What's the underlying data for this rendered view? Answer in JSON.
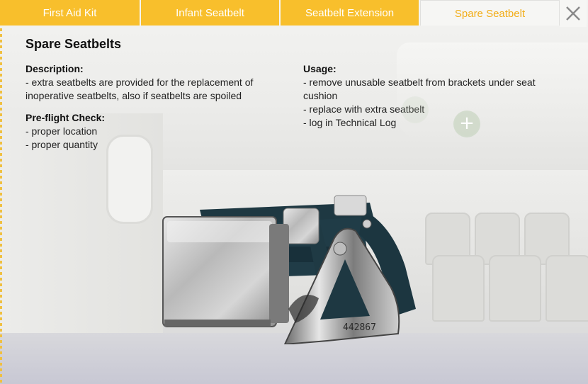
{
  "tabs": [
    {
      "label": "First Aid Kit",
      "active": false
    },
    {
      "label": "Infant Seatbelt",
      "active": false
    },
    {
      "label": "Seatbelt Extension",
      "active": false
    },
    {
      "label": "Spare Seatbelt",
      "active": true
    }
  ],
  "close_icon": "close-icon",
  "title": "Spare Seatbelts",
  "description": {
    "heading": "Description:",
    "lines": [
      "- extra seatbelts are provided for the replacement of",
      "inoperative seatbelts, also if seatbelts are spoiled"
    ]
  },
  "preflight": {
    "heading": "Pre-flight Check:",
    "lines": [
      "- proper location",
      "- proper quantity"
    ]
  },
  "usage": {
    "heading": "Usage:",
    "lines": [
      "- remove unusable seatbelt from brackets under seat",
      "cushion",
      "- replace with extra seatbelt",
      "- log in Technical Log"
    ]
  },
  "product": {
    "serial": "442867"
  },
  "colors": {
    "tab_bg": "#f8bf2c",
    "tab_active_text": "#f2ad18",
    "strap": "#1e3842"
  }
}
